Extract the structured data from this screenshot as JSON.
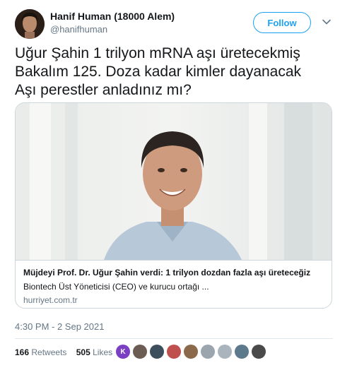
{
  "author": {
    "display_name": "Hanif Human (18000 Alem)",
    "handle": "@hanifhuman",
    "follow_label": "Follow"
  },
  "tweet": {
    "lines": [
      "Uğur Şahin 1 trilyon mRNA aşı üretecekmiş",
      "Bakalım 125. Doza kadar kimler dayanacak",
      "Aşı perestler anladınız mı?"
    ],
    "timestamp": "4:30 PM - 2 Sep 2021"
  },
  "card": {
    "title": "Müjdeyi Prof. Dr. Uğur Şahin verdi: 1 trilyon dozdan fazla aşı üreteceğiz",
    "description": "Biontech Üst Yöneticisi (CEO) ve kurucu ortağı ...",
    "domain": "hurriyet.com.tr"
  },
  "stats": {
    "retweets_count": "166",
    "retweets_label": "Retweets",
    "likes_count": "505",
    "likes_label": "Likes"
  },
  "likers": [
    {
      "initial": "K",
      "color": "#7b3fc4"
    },
    {
      "initial": "",
      "color": "#6b5d54"
    },
    {
      "initial": "",
      "color": "#3d4f5c"
    },
    {
      "initial": "",
      "color": "#c0504d"
    },
    {
      "initial": "",
      "color": "#8a6a4a"
    },
    {
      "initial": "",
      "color": "#9aa5ae"
    },
    {
      "initial": "",
      "color": "#aab4bc"
    },
    {
      "initial": "",
      "color": "#5d7a8c"
    },
    {
      "initial": "",
      "color": "#4a4a4a"
    }
  ],
  "colors": {
    "accent": "#1da1f2",
    "secondary_text": "#657786",
    "border": "#ccd6dd"
  }
}
